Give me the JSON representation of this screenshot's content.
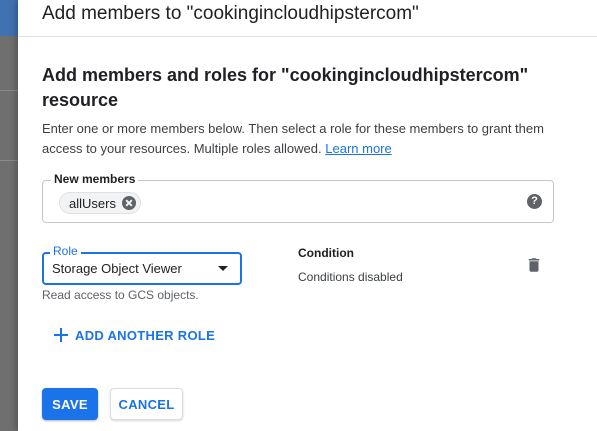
{
  "panel": {
    "title": "Add members to \"cookingincloudhipstercom\""
  },
  "section": {
    "title": "Add members and roles for \"cookingincloudhipstercom\" resource",
    "description": "Enter one or more members below. Then select a role for these members to grant them access to your resources. Multiple roles allowed.",
    "learn_more": "Learn more"
  },
  "members": {
    "label": "New members",
    "chips": [
      "allUsers"
    ],
    "help_icon": "help-icon",
    "help_glyph": "?"
  },
  "role": {
    "label": "Role",
    "selected": "Storage Object Viewer",
    "help_text": "Read access to GCS objects."
  },
  "condition": {
    "title": "Condition",
    "value": "Conditions disabled"
  },
  "actions": {
    "add_role": "ADD ANOTHER ROLE",
    "save": "SAVE",
    "cancel": "CANCEL"
  },
  "colors": {
    "accent": "#1a73e8",
    "text": "#202124",
    "muted": "#5f6368"
  }
}
